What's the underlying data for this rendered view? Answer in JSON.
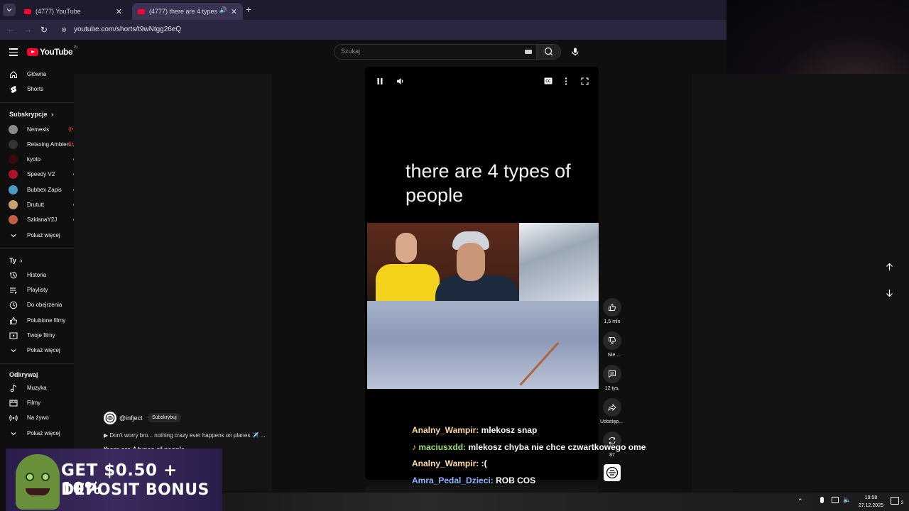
{
  "browser": {
    "tabs": [
      {
        "title": "(4777) YouTube",
        "active": false
      },
      {
        "title": "(4777) there are 4 types of",
        "active": true
      }
    ],
    "url": "youtube.com/shorts/t9wNtgg26eQ"
  },
  "header": {
    "logo_text": "YouTube",
    "logo_region": "PL",
    "search_placeholder": "Szukaj"
  },
  "sidebar": {
    "main": [
      {
        "label": "Główna",
        "icon": "home-icon"
      },
      {
        "label": "Shorts",
        "icon": "shorts-icon"
      }
    ],
    "subscriptions_heading": "Subskrypcje",
    "subscriptions": [
      {
        "label": "Nemesis",
        "live": true,
        "color": "#8a8a8a"
      },
      {
        "label": "Relaxing Ambien...",
        "live": true,
        "color": "#333333"
      },
      {
        "label": "kyoto",
        "live": false,
        "color": "#3a0a0a"
      },
      {
        "label": "Speedy V2",
        "live": false,
        "color": "#b0102a"
      },
      {
        "label": "Bubbex Zapis",
        "live": false,
        "color": "#4a9bc8"
      },
      {
        "label": "Drututt",
        "live": false,
        "color": "#c8a070"
      },
      {
        "label": "SzklanaY2J",
        "live": false,
        "color": "#c06040"
      }
    ],
    "subs_more": "Pokaż więcej",
    "you_heading": "Ty",
    "you": [
      {
        "label": "Historia",
        "icon": "history-icon"
      },
      {
        "label": "Playlisty",
        "icon": "playlist-icon"
      },
      {
        "label": "Do obejrzenia",
        "icon": "clock-icon"
      },
      {
        "label": "Polubione filmy",
        "icon": "thumb-up-icon"
      },
      {
        "label": "Twoje filmy",
        "icon": "play-square-icon"
      }
    ],
    "you_more": "Pokaż więcej",
    "explore_heading": "Odkrywaj",
    "explore": [
      {
        "label": "Muzyka",
        "icon": "music-icon"
      },
      {
        "label": "Filmy",
        "icon": "film-icon"
      },
      {
        "label": "Na żywo",
        "icon": "live-icon"
      }
    ],
    "explore_more": "Pokaż więcej"
  },
  "short": {
    "caption": "there are 4 types of people",
    "channel": "@infject",
    "subscribe_label": "Subskrybuj",
    "description": "▶ Don't worry bro... nothing crazy ever happens on planes ✈️ ...",
    "title_partial": "there are 4 types of people",
    "actions": {
      "likes": "1,5 mln",
      "dislike": "Nie ...",
      "comments": "12 tys.",
      "share": "Udostęp...",
      "remix": "87"
    }
  },
  "chat": [
    {
      "user": "Analny_Wampir:",
      "message": "mlekosz snap",
      "user_color": "#ffd9a0",
      "prefix": ""
    },
    {
      "user": "maciusxdd:",
      "message": "mlekosz chyba nie chce czwartkowego ome",
      "user_color": "#9be07a",
      "prefix": "♪"
    },
    {
      "user": "Analny_Wampir:",
      "message": ":(",
      "user_color": "#ffd9a0",
      "prefix": ""
    },
    {
      "user": "Amra_Pedal_Dzieci:",
      "message": "ROB COS",
      "user_color": "#8fb4ff",
      "prefix": ""
    }
  ],
  "ad": {
    "line1": "GET $0.50 + 10%",
    "line2": "DEPOSIT BONUS"
  },
  "taskbar": {
    "time": "19:58",
    "date": "27.12.2025",
    "notifications": "3"
  }
}
